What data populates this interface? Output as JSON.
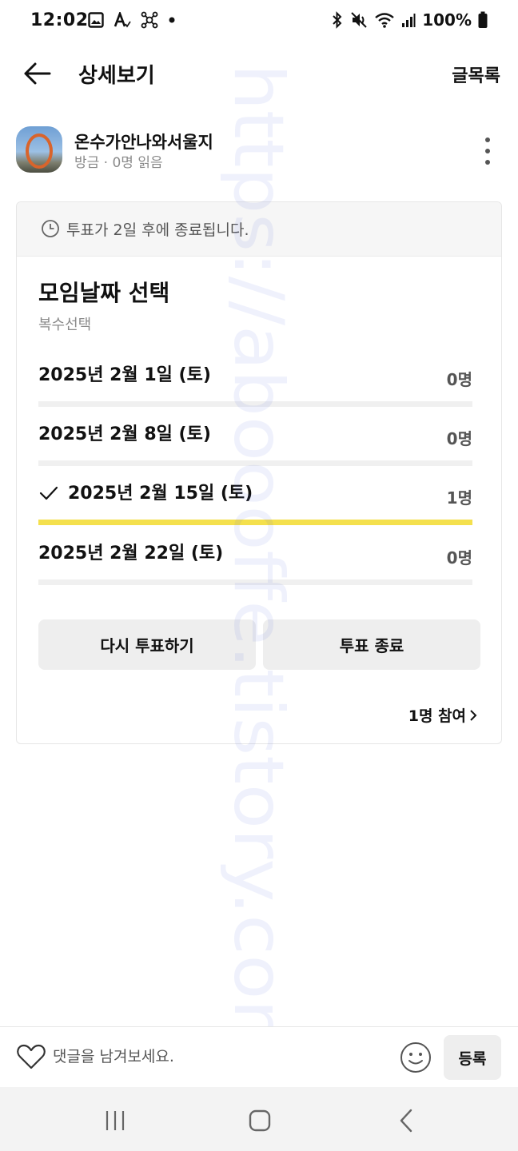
{
  "status_bar": {
    "time": "12:02",
    "battery": "100%",
    "icons": [
      "gallery-icon",
      "font-icon",
      "nodes-icon",
      "dot-icon",
      "bluetooth-icon",
      "mute-icon",
      "wifi-icon",
      "signal-icon",
      "battery-icon"
    ]
  },
  "app_bar": {
    "back_icon": "arrow-left-icon",
    "title": "상세보기",
    "list_link": "글목록"
  },
  "author": {
    "name": "온수가안나와서울지",
    "meta": "방금 · 0명 읽음"
  },
  "poll": {
    "notice": "투표가 2일 후에 종료됩니다.",
    "title": "모임날짜 선택",
    "subtitle": "복수선택",
    "options": [
      {
        "label": "2025년 2월 1일 (토)",
        "count": "0명",
        "share": 0,
        "checked": false
      },
      {
        "label": "2025년 2월 8일 (토)",
        "count": "0명",
        "share": 0,
        "checked": false
      },
      {
        "label": "2025년 2월 15일 (토)",
        "count": "1명",
        "share": 1,
        "checked": true
      },
      {
        "label": "2025년 2월 22일 (토)",
        "count": "0명",
        "share": 0,
        "checked": false
      }
    ],
    "revote_label": "다시 투표하기",
    "end_label": "투표 종료",
    "participants": "1명 참여"
  },
  "watermark": "https://aboooffe.tistory.com/",
  "comment": {
    "placeholder": "댓글을 남겨보세요.",
    "submit_label": "등록"
  },
  "colors": {
    "accent_bar": "#f4e04d",
    "button_bg": "#eeeeee",
    "muted_text": "#8a8a8a"
  }
}
